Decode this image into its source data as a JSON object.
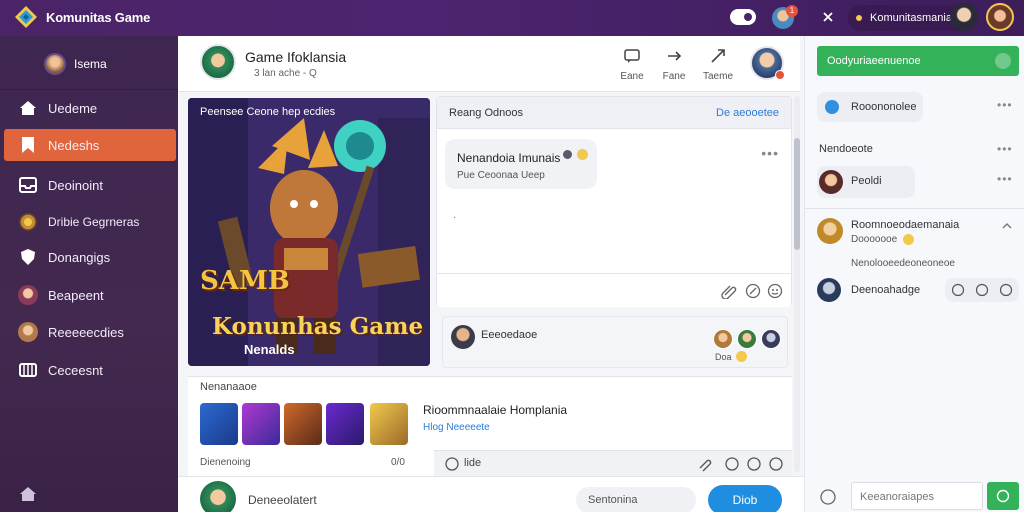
{
  "topbar": {
    "app_title": "Komunitas Game",
    "notif_count": "1",
    "user_name": "Komunitasmania"
  },
  "sidebar": {
    "profile_name": "Isema",
    "items": [
      {
        "label": "Uedeme",
        "icon": "home-icon"
      },
      {
        "label": "Nedeshs",
        "icon": "bookmark-icon",
        "active": true
      },
      {
        "label": "Deoinoint",
        "icon": "inbox-icon"
      },
      {
        "label": "Dribie Gegrneras",
        "icon": "globe-icon"
      },
      {
        "label": "Donangigs",
        "icon": "shield-icon"
      },
      {
        "label": "Beapeent",
        "icon": "user-avatar-icon"
      },
      {
        "label": "Reeeeecdies",
        "icon": "user-avatar-icon"
      },
      {
        "label": "Ceceesnt",
        "icon": "grid-icon"
      }
    ]
  },
  "center_header": {
    "title": "Game Ifoklansia",
    "subtitle": "3 lan ache - Q",
    "buttons": [
      {
        "label": "Eane",
        "icon": "chat-icon"
      },
      {
        "label": "Fane",
        "icon": "share-icon"
      },
      {
        "label": "Taeme",
        "icon": "send-icon"
      }
    ]
  },
  "banner": {
    "tag": "Peensee Ceone hep ecdies",
    "title_small": "SAMB",
    "title_big": "Konunhas Game",
    "caption": "Nenalds"
  },
  "chat": {
    "header_title": "Reang Odnoos",
    "header_link": "De aeooetee",
    "message_author": "Nenandoia Imunais",
    "message_text": "Pue Ceoonaa Ueep",
    "typing": "."
  },
  "reply": {
    "name": "Eeeoedaoe",
    "count": "Doa"
  },
  "recommend": {
    "section_title": "Nenanaaoe",
    "title": "Rioommnaalaie Homplania",
    "subtitle": "Hlog Neeeeete",
    "footer_label": "Dienenoing",
    "footer_count": "0/0",
    "toolbar_label": "lide"
  },
  "bottombar": {
    "label": "Deneeolatert",
    "search_placeholder": "Sentonina",
    "button_label": "Diob"
  },
  "right_panel": {
    "header": "Oodyuriaeenuenoe",
    "chip1": "Rooononolee",
    "section_label": "Nendoeote",
    "item1_name": "Peoldi",
    "item2_title": "Roomnoeodaemanaia",
    "item2_sub": "Dooooooe",
    "item2_detail": "Nenolooeedeoneoneoe",
    "item3_name": "Deenoahadge",
    "input_placeholder": "Keeanoraiapes"
  },
  "colors": {
    "accent_active": "#e0643c",
    "topbar": "#4a2466",
    "sidebar": "#3d2650",
    "green": "#34b25a",
    "blue_button": "#1f8ee0"
  }
}
